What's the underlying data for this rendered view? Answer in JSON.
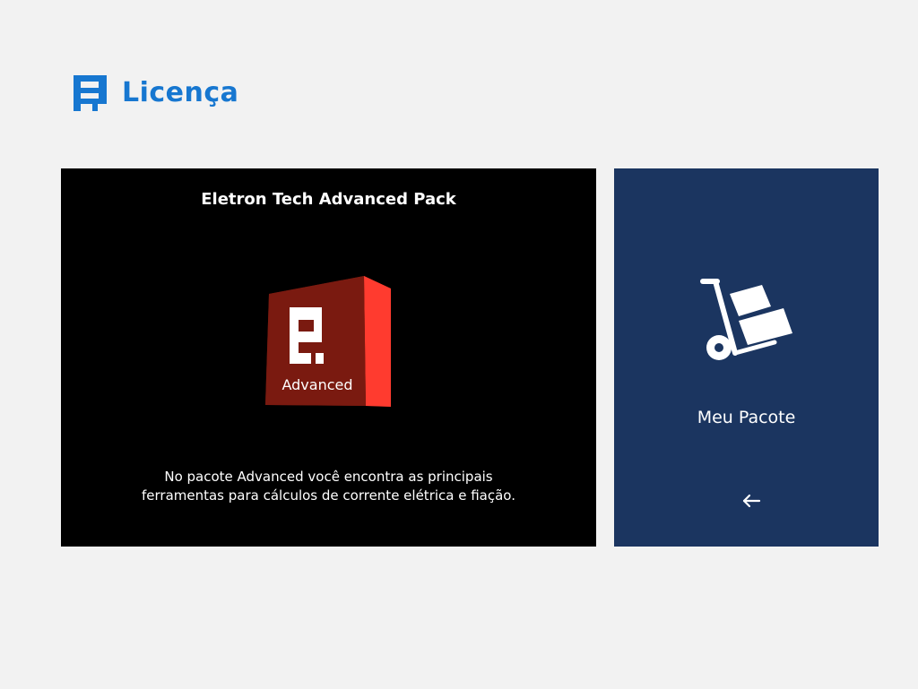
{
  "header": {
    "logo_icon": "eletron-logo-icon",
    "title": "Licença",
    "accent_color": "#1777d0"
  },
  "pack": {
    "title": "Eletron Tech Advanced Pack",
    "box_label": "Advanced",
    "description_line1": "No pacote Advanced você encontra as principais",
    "description_line2": "ferramentas para cálculos de corrente elétrica e fiação.",
    "box_icon": "advanced-pack-box-icon",
    "background_color": "#000000",
    "box_front_color": "#7a1a10",
    "box_side_color": "#ff3b2f"
  },
  "my_pack": {
    "label": "Meu Pacote",
    "icon": "hand-truck-icon",
    "back_icon": "arrow-left-icon",
    "background_color": "#1b3560"
  }
}
